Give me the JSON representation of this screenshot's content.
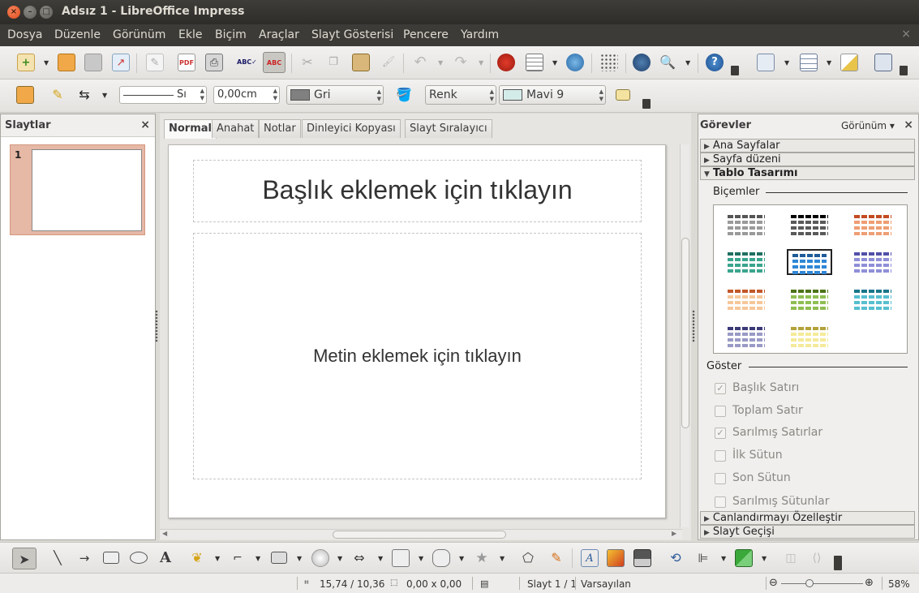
{
  "window": {
    "title": "Adsız 1 - LibreOffice Impress",
    "buttons": [
      "×",
      "–",
      "□"
    ]
  },
  "menu": [
    {
      "label": "Dosya",
      "key": "dosya"
    },
    {
      "label": "Düzenle",
      "key": "duzenle"
    },
    {
      "label": "Görünüm",
      "key": "gorunum"
    },
    {
      "label": "Ekle",
      "key": "ekle"
    },
    {
      "label": "Biçim",
      "key": "bicim"
    },
    {
      "label": "Araçlar",
      "key": "araclar"
    },
    {
      "label": "Slayt Gösterisi",
      "key": "slayt-gosterisi"
    },
    {
      "label": "Pencere",
      "key": "pencere"
    },
    {
      "label": "Yardım",
      "key": "yardim"
    }
  ],
  "menu_close": "×",
  "line_props": {
    "line_style_value": "Sı",
    "line_width_value": "0,00cm",
    "line_color_value": "Gri",
    "area_style_value": "Renk",
    "area_color_value": "Mavi 9",
    "line_color_hex": "#808080",
    "area_color_hex": "#d4ece9"
  },
  "slides_panel": {
    "title": "Slaytlar",
    "close": "×",
    "slides": [
      {
        "number": "1"
      }
    ]
  },
  "view_tabs": [
    {
      "label": "Normal",
      "active": true
    },
    {
      "label": "Anahat",
      "active": false
    },
    {
      "label": "Notlar",
      "active": false
    },
    {
      "label": "Dinleyici Kopyası",
      "active": false
    },
    {
      "label": "Slayt Sıralayıcı",
      "active": false
    }
  ],
  "slide": {
    "title_placeholder": "Başlık eklemek için tıklayın",
    "body_placeholder": "Metin eklemek için tıklayın"
  },
  "tasks_panel": {
    "title": "Görevler",
    "view_label": "Görünüm",
    "view_arrow": "▾",
    "close": "×",
    "sections_top": [
      {
        "label": "Ana Sayfalar",
        "expanded": false
      },
      {
        "label": "Sayfa düzeni",
        "expanded": false
      },
      {
        "label": "Tablo Tasarımı",
        "expanded": true
      }
    ],
    "styles_label": "Biçemler",
    "table_styles": [
      {
        "name": "gray",
        "header": "#555555",
        "row": "#9a9a9a",
        "selected": false
      },
      {
        "name": "black",
        "header": "#000000",
        "row": "#5a5a5a",
        "selected": false
      },
      {
        "name": "orange-red",
        "header": "#c44a22",
        "row": "#ee9e74",
        "selected": false
      },
      {
        "name": "teal-green",
        "header": "#1e6f62",
        "row": "#3aa58e",
        "selected": false
      },
      {
        "name": "blue",
        "header": "#1d5c99",
        "row": "#2f87d6",
        "selected": true
      },
      {
        "name": "lavender",
        "header": "#5050a8",
        "row": "#8f8fd8",
        "selected": false
      },
      {
        "name": "orange",
        "header": "#c2572a",
        "row": "#f6c79a",
        "selected": false
      },
      {
        "name": "olive-green",
        "header": "#4c7318",
        "row": "#8fbe53",
        "selected": false
      },
      {
        "name": "cyan",
        "header": "#19778a",
        "row": "#57bfd0",
        "selected": false
      },
      {
        "name": "navy",
        "header": "#3a3a78",
        "row": "#9a9ac6",
        "selected": false
      },
      {
        "name": "yellow",
        "header": "#b3a23a",
        "row": "#f5ea9a",
        "selected": false
      }
    ],
    "show_label": "Göster",
    "options": [
      {
        "label": "Başlık Satırı",
        "checked": true
      },
      {
        "label": "Toplam Satır",
        "checked": false
      },
      {
        "label": "Sarılmış Satırlar",
        "checked": true
      },
      {
        "label": "İlk Sütun",
        "checked": false
      },
      {
        "label": "Son Sütun",
        "checked": false
      },
      {
        "label": "Sarılmış Sütunlar",
        "checked": false
      }
    ],
    "sections_bottom": [
      {
        "label": "Canlandırmayı Özelleştir",
        "expanded": false
      },
      {
        "label": "Slayt Geçişi",
        "expanded": false
      }
    ]
  },
  "statusbar": {
    "position": "15,74 / 10,36",
    "size": "0,00 x 0,00",
    "slide": "Slayt 1 / 1",
    "master": "Varsayılan",
    "zoom_minus": "⊖",
    "zoom_plus": "⊕",
    "zoom": "58%",
    "zoom_fraction": 0.35
  }
}
